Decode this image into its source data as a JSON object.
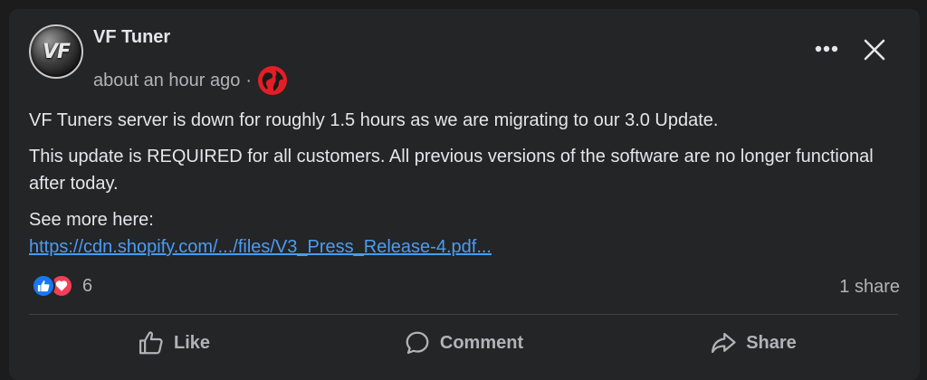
{
  "post": {
    "author": "VF Tuner",
    "avatar_text": "VF",
    "timestamp": "about an hour ago",
    "separator": "·",
    "audience_icon": "globe-icon"
  },
  "header": {
    "more_icon": "more-options-icon",
    "close_icon": "close-icon"
  },
  "content": {
    "paragraph1": "VF Tuners server is down for roughly 1.5 hours as we are migrating to our 3.0 Update.",
    "paragraph2": "This update is REQUIRED for all customers. All previous versions of the software are no longer functional after today.",
    "see_more": "See more here:",
    "link": "https://cdn.shopify.com/.../files/V3_Press_Release-4.pdf..."
  },
  "stats": {
    "reaction_count": "6",
    "reactions": [
      "like",
      "love"
    ],
    "shares": "1 share"
  },
  "actions": {
    "like": "Like",
    "comment": "Comment",
    "share": "Share"
  },
  "colors": {
    "background": "#242526",
    "link": "#4b9cf5",
    "like": "#1877f2",
    "love": "#f33e58",
    "globe": "#e41e26"
  }
}
